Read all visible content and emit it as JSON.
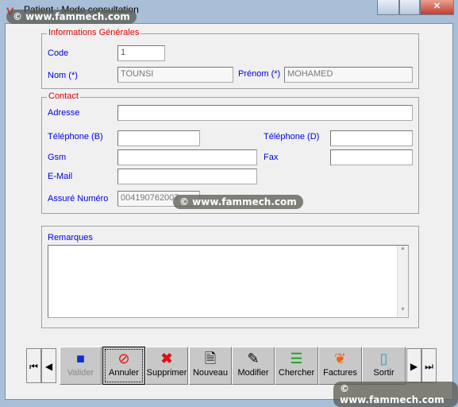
{
  "window": {
    "title": "Patient : Mode consultation"
  },
  "general": {
    "legend": "Informations Générales",
    "code_label": "Code",
    "code_value": "1",
    "nom_label": "Nom (*)",
    "nom_value": "TOUNSI",
    "prenom_label": "Prénom (*)",
    "prenom_value": "MOHAMED"
  },
  "contact": {
    "legend": "Contact",
    "adresse_label": "Adresse",
    "adresse_value": "",
    "tel_b_label": "Téléphone (B)",
    "tel_b_value": "",
    "tel_d_label": "Téléphone (D)",
    "tel_d_value": "",
    "gsm_label": "Gsm",
    "gsm_value": "",
    "fax_label": "Fax",
    "fax_value": "",
    "email_label": "E-Mail",
    "email_value": "",
    "assure_label": "Assuré Numéro",
    "assure_value": "004190762007"
  },
  "remarques": {
    "label": "Remarques",
    "value": ""
  },
  "toolbar": {
    "valider": "Valider",
    "annuler": "Annuler",
    "supprimer": "Supprimer",
    "nouveau": "Nouveau",
    "modifier": "Modifier",
    "chercher": "Chercher",
    "factures": "Factures",
    "sortir": "Sortir"
  },
  "watermark": "© www.fammech.com"
}
